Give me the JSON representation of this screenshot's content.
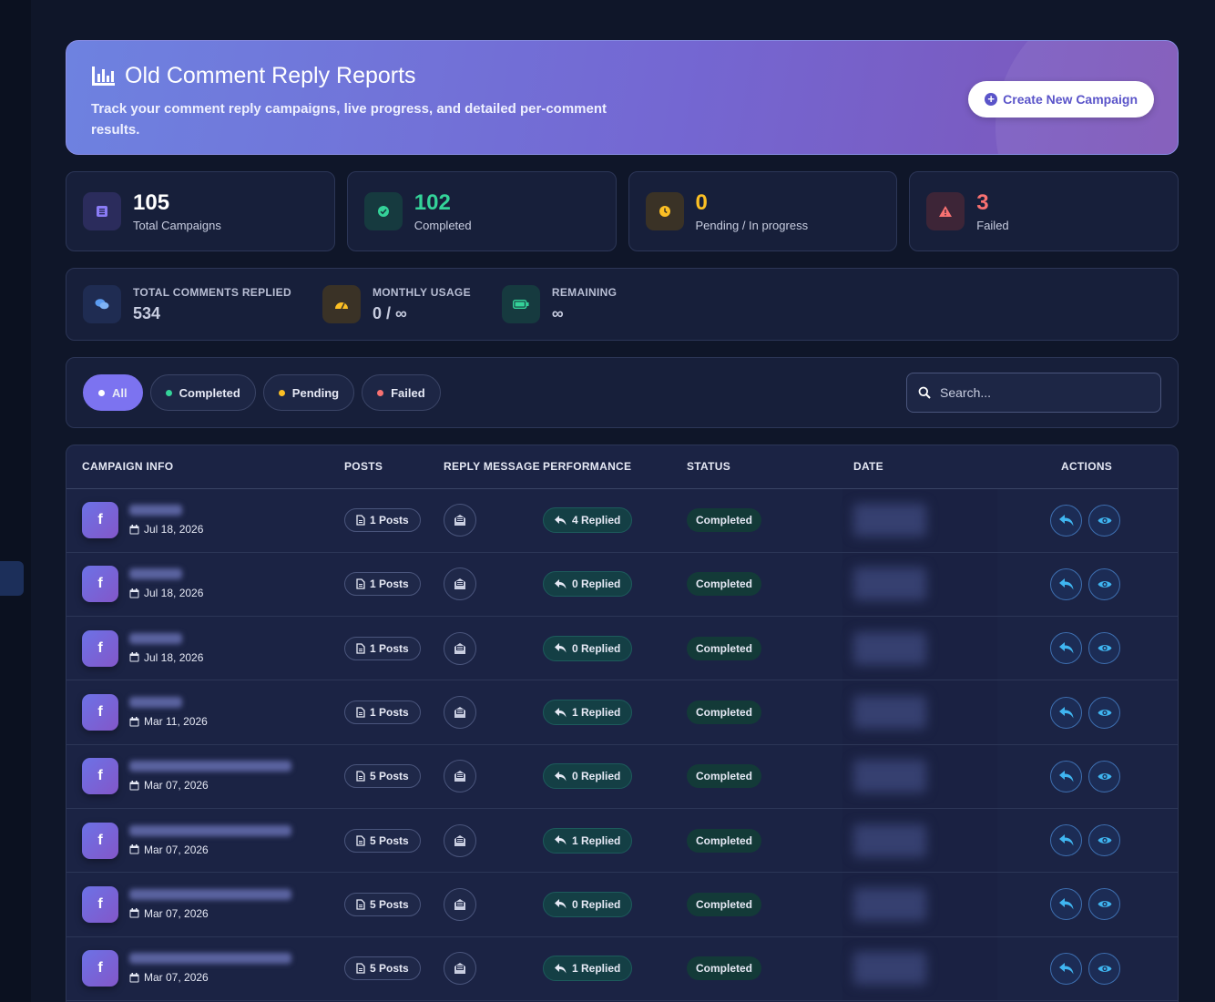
{
  "header": {
    "title": "Old Comment Reply Reports",
    "subtitle": "Track your comment reply campaigns, live progress, and detailed per-comment results.",
    "create_button": "Create New Campaign"
  },
  "stats": [
    {
      "value": "105",
      "label": "Total Campaigns",
      "color": "#ffffff",
      "icon": "list-icon"
    },
    {
      "value": "102",
      "label": "Completed",
      "color": "#34d399",
      "icon": "check-circle-icon"
    },
    {
      "value": "0",
      "label": "Pending / In progress",
      "color": "#fbbf24",
      "icon": "clock-icon"
    },
    {
      "value": "3",
      "label": "Failed",
      "color": "#f87171",
      "icon": "warning-icon"
    }
  ],
  "usage": [
    {
      "title": "TOTAL COMMENTS REPLIED",
      "value": "534",
      "icon": "comments-icon"
    },
    {
      "title": "MONTHLY USAGE",
      "value": "0 / ∞",
      "icon": "gauge-icon"
    },
    {
      "title": "REMAINING",
      "value": "∞",
      "icon": "battery-icon"
    }
  ],
  "filters": {
    "pills": [
      {
        "label": "All",
        "dot_color": "#ffffff",
        "active": true
      },
      {
        "label": "Completed",
        "dot_color": "#34d399",
        "active": false
      },
      {
        "label": "Pending",
        "dot_color": "#fbbf24",
        "active": false
      },
      {
        "label": "Failed",
        "dot_color": "#f87171",
        "active": false
      }
    ],
    "search_placeholder": "Search..."
  },
  "table": {
    "columns": [
      "CAMPAIGN INFO",
      "POSTS",
      "REPLY MESSAGE",
      "PERFORMANCE",
      "STATUS",
      "DATE",
      "ACTIONS"
    ],
    "rows": [
      {
        "date": "Jul 18, 2026",
        "posts": "1 Posts",
        "replied": "4 Replied",
        "status": "Completed",
        "name_width": 58
      },
      {
        "date": "Jul 18, 2026",
        "posts": "1 Posts",
        "replied": "0 Replied",
        "status": "Completed",
        "name_width": 58
      },
      {
        "date": "Jul 18, 2026",
        "posts": "1 Posts",
        "replied": "0 Replied",
        "status": "Completed",
        "name_width": 58
      },
      {
        "date": "Mar 11, 2026",
        "posts": "1 Posts",
        "replied": "1 Replied",
        "status": "Completed",
        "name_width": 58
      },
      {
        "date": "Mar 07, 2026",
        "posts": "5 Posts",
        "replied": "0 Replied",
        "status": "Completed",
        "name_width": 178
      },
      {
        "date": "Mar 07, 2026",
        "posts": "5 Posts",
        "replied": "1 Replied",
        "status": "Completed",
        "name_width": 178
      },
      {
        "date": "Mar 07, 2026",
        "posts": "5 Posts",
        "replied": "0 Replied",
        "status": "Completed",
        "name_width": 178
      },
      {
        "date": "Mar 07, 2026",
        "posts": "5 Posts",
        "replied": "1 Replied",
        "status": "Completed",
        "name_width": 178
      }
    ]
  }
}
